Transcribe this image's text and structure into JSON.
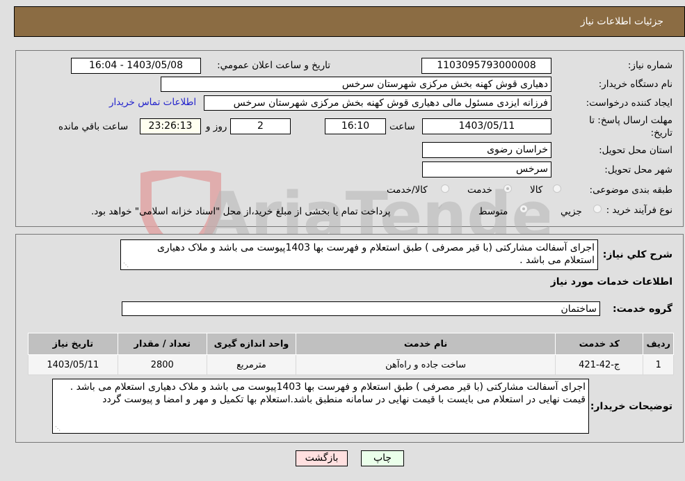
{
  "header": {
    "title": "جزئیات اطلاعات نیاز"
  },
  "form": {
    "need_number": {
      "label": "شماره نیاز:",
      "value": "1103095793000008"
    },
    "announce_datetime": {
      "label": "تاریخ و ساعت اعلان عمومي:",
      "value": "1403/05/08 - 16:04"
    },
    "buyer_org": {
      "label": "نام دستگاه خریدار:",
      "value": "دهیاری قوش کهنه بخش مرکزی شهرستان سرخس"
    },
    "requester": {
      "label": "ایجاد کننده درخواست:",
      "value": "فرزانه ایزدی مسئول مالی دهیاری قوش کهنه بخش مرکزی شهرستان سرخس",
      "contact_link": "اطلاعات تماس خریدار"
    },
    "deadline": {
      "label": "مهلت ارسال پاسخ: تا تاریخ:",
      "date": "1403/05/11",
      "time_label": "ساعت",
      "time": "16:10",
      "days": "2",
      "days_label": "روز و",
      "remaining": "23:26:13",
      "remaining_label": "ساعت باقي مانده"
    },
    "province": {
      "label": "استان محل تحویل:",
      "value": "خراسان رضوی"
    },
    "city": {
      "label": "شهر محل تحویل:",
      "value": "سرخس"
    },
    "category": {
      "label": "طبقه بندی موضوعی:",
      "options": [
        "کالا",
        "خدمت",
        "کالا/خدمت"
      ],
      "selected": "خدمت"
    },
    "purchase_type": {
      "label": "نوع فرآیند خرید :",
      "options": [
        "جزیي",
        "متوسط"
      ],
      "selected": "متوسط",
      "treasury_note": "پرداخت تمام یا بخشی از مبلغ خرید،از محل \"اسناد خزانه اسلامی\" خواهد بود."
    }
  },
  "details": {
    "summary_label": "شرح کلي نیاز:",
    "summary_value": "اجرای آسفالت مشارکتی (با قیر مصرفی ) طبق استعلام و فهرست بها 1403پیوست می باشد و ملاک دهیاری استعلام می باشد .",
    "services_heading": "اطلاعات خدمات مورد نیاز",
    "service_group_label": "گروه خدمت:",
    "service_group_value": "ساختمان",
    "table": {
      "headers": [
        "ردیف",
        "کد خدمت",
        "نام خدمت",
        "واحد اندازه گیری",
        "تعداد / مقدار",
        "تاریخ نیاز"
      ],
      "rows": [
        [
          "1",
          "ج-42-421",
          "ساخت جاده و راه‌آهن",
          "مترمربع",
          "2800",
          "1403/05/11"
        ]
      ]
    },
    "buyer_notes_label": "توضیحات خریدار:",
    "buyer_notes_value": "اجرای آسفالت مشارکتی (با قیر مصرفی ) طبق استعلام و فهرست بها 1403پیوست می باشد و ملاک دهیاری استعلام می باشد . قیمت نهایی در استعلام می بایست با قیمت نهایی در سامانه منطبق باشد.استعلام بها تکمیل و مهر و امضا و پیوست گردد"
  },
  "buttons": {
    "print": "چاپ",
    "back": "بازگشت"
  },
  "watermark": {
    "text": "AriaTender.neT"
  },
  "colors": {
    "header_bg": "#8b6c43",
    "back_bg": "#ffe0e0",
    "print_bg": "#eaffea",
    "link": "#2222cc"
  }
}
